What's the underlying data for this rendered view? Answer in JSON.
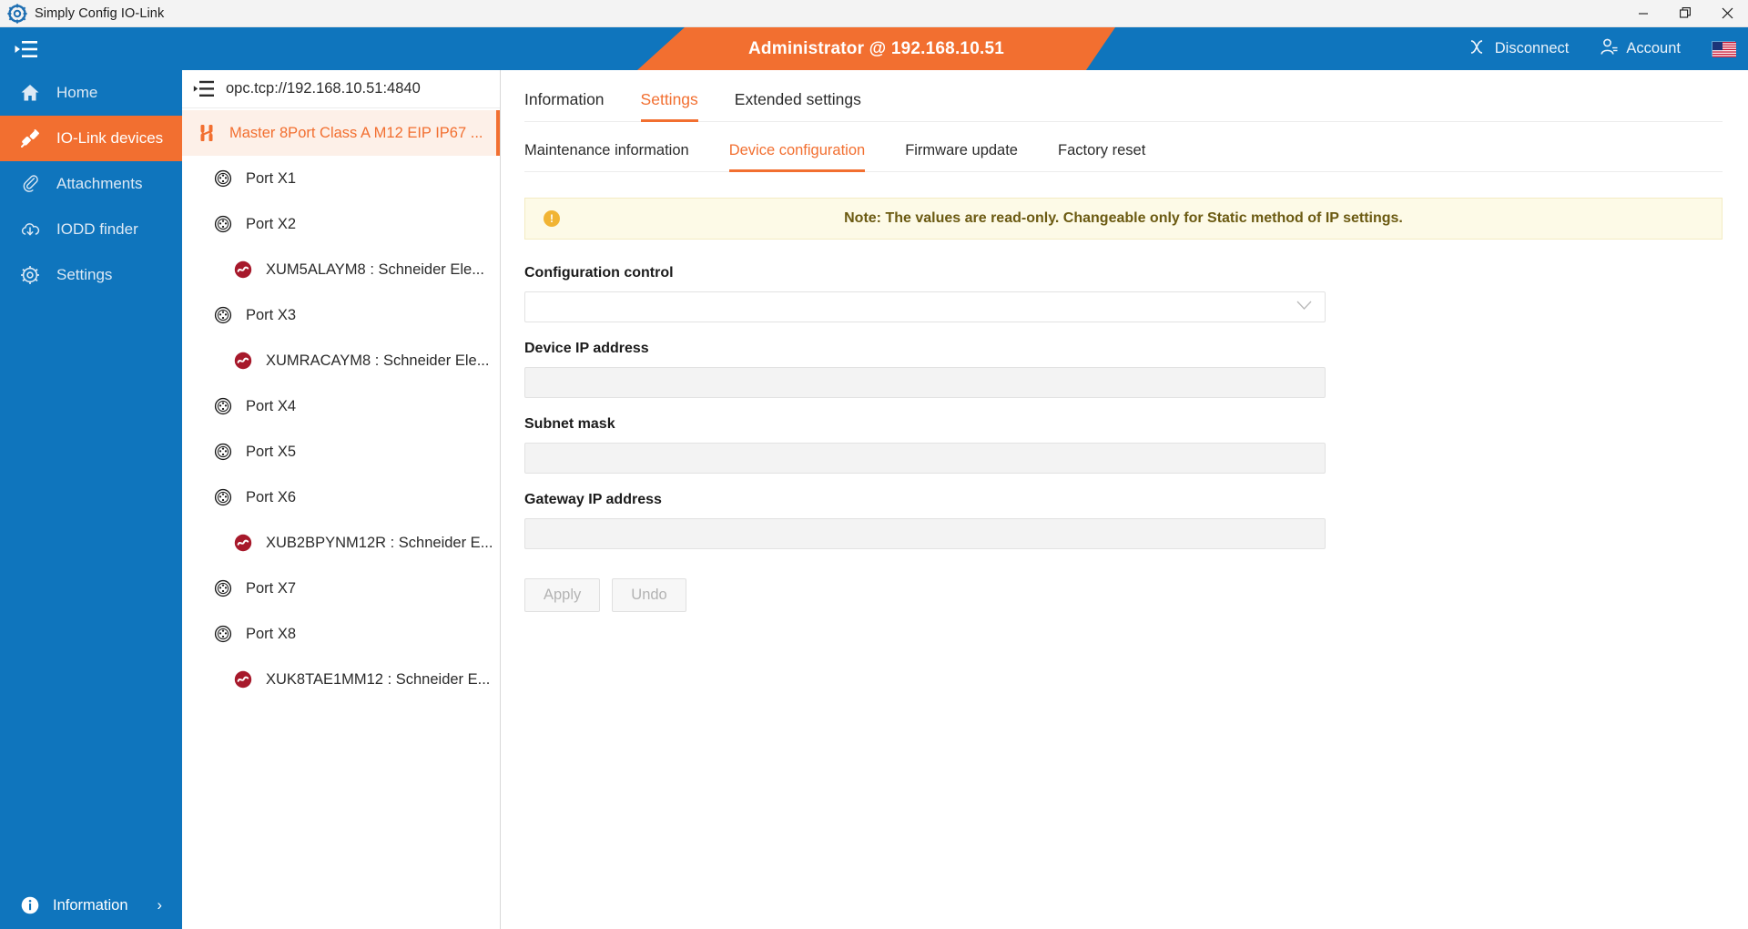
{
  "window": {
    "title": "Simply Config IO-Link",
    "app_icon": "gear-app-icon",
    "minimize": "—",
    "maximize": "❐",
    "close": "✕"
  },
  "appbar": {
    "collapse_icon": "collapse-menu-icon",
    "banner_text": "Administrator @ 192.168.10.51",
    "disconnect_label": "Disconnect",
    "disconnect_icon": "disconnect-icon",
    "account_label": "Account",
    "account_icon": "account-icon",
    "language_icon": "us-flag-icon",
    "accent_blue": "#0f75bd",
    "accent_orange": "#f26f30"
  },
  "sidebar": {
    "items": [
      {
        "label": "Home",
        "icon": "home-icon",
        "selected": false
      },
      {
        "label": "IO-Link devices",
        "icon": "io-link-plug-icon",
        "selected": true
      },
      {
        "label": "Attachments",
        "icon": "paperclip-icon",
        "selected": false
      },
      {
        "label": "IODD finder",
        "icon": "cloud-download-icon",
        "selected": false
      },
      {
        "label": "Settings",
        "icon": "gear-icon",
        "selected": false
      }
    ],
    "bottom": {
      "label": "Information",
      "icon": "info-circle-icon",
      "chevron": "›"
    }
  },
  "tree": {
    "collapse_icon": "collapse-tree-icon",
    "endpoint": "opc.tcp://192.168.10.51:4840",
    "nodes": [
      {
        "label": "Master 8Port Class A M12 EIP IP67 ...",
        "type": "master",
        "icon": "master-icon",
        "selected": true
      },
      {
        "label": "Port X1",
        "type": "port",
        "icon": "port-connector-icon",
        "selected": false
      },
      {
        "label": "Port X2",
        "type": "port",
        "icon": "port-connector-icon",
        "selected": false
      },
      {
        "label": "XUM5ALAYM8 : Schneider Ele...",
        "type": "device",
        "icon": "io-link-device-icon",
        "selected": false
      },
      {
        "label": "Port X3",
        "type": "port",
        "icon": "port-connector-icon",
        "selected": false
      },
      {
        "label": "XUMRACAYM8 : Schneider Ele...",
        "type": "device",
        "icon": "io-link-device-icon",
        "selected": false
      },
      {
        "label": "Port X4",
        "type": "port",
        "icon": "port-connector-icon",
        "selected": false
      },
      {
        "label": "Port X5",
        "type": "port",
        "icon": "port-connector-icon",
        "selected": false
      },
      {
        "label": "Port X6",
        "type": "port",
        "icon": "port-connector-icon",
        "selected": false
      },
      {
        "label": "XUB2BPYNM12R : Schneider E...",
        "type": "device",
        "icon": "io-link-device-icon",
        "selected": false
      },
      {
        "label": "Port X7",
        "type": "port",
        "icon": "port-connector-icon",
        "selected": false
      },
      {
        "label": "Port X8",
        "type": "port",
        "icon": "port-connector-icon",
        "selected": false
      },
      {
        "label": "XUK8TAE1MM12 : Schneider E...",
        "type": "device",
        "icon": "io-link-device-icon",
        "selected": false
      }
    ]
  },
  "main": {
    "primary_tabs": [
      {
        "label": "Information",
        "active": false
      },
      {
        "label": "Settings",
        "active": true
      },
      {
        "label": "Extended settings",
        "active": false
      }
    ],
    "secondary_tabs": [
      {
        "label": "Maintenance information",
        "active": false
      },
      {
        "label": "Device configuration",
        "active": true
      },
      {
        "label": "Firmware update",
        "active": false
      },
      {
        "label": "Factory reset",
        "active": false
      }
    ],
    "note": {
      "icon": "warning-exclamation-icon",
      "text": "Note: The values are read-only. Changeable only for Static method of IP settings."
    },
    "fields": [
      {
        "label": "Configuration control",
        "value": "",
        "kind": "select",
        "chevron_icon": "chevron-down-icon"
      },
      {
        "label": "Device IP address",
        "value": "",
        "kind": "readonly-input"
      },
      {
        "label": "Subnet mask",
        "value": "",
        "kind": "readonly-input"
      },
      {
        "label": "Gateway IP address",
        "value": "",
        "kind": "readonly-input"
      }
    ],
    "buttons": [
      {
        "label": "Apply",
        "disabled": true
      },
      {
        "label": "Undo",
        "disabled": true
      }
    ]
  }
}
